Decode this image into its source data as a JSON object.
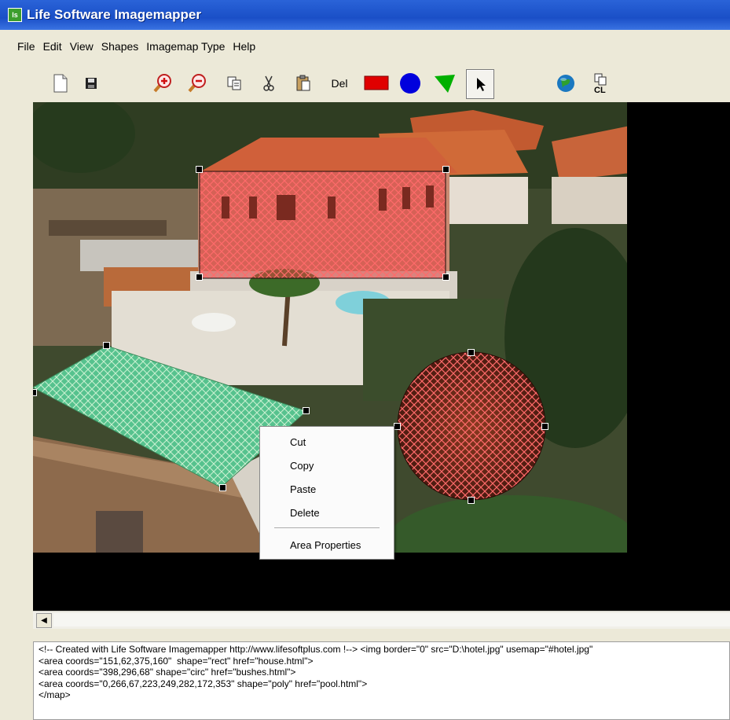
{
  "window": {
    "title": "Life Software Imagemapper",
    "app_icon_label": "ls"
  },
  "menu": [
    "File",
    "Edit",
    "View",
    "Shapes",
    "Imagemap Type",
    "Help"
  ],
  "toolbar": {
    "del_label": "Del"
  },
  "context_menu": {
    "items": [
      "Cut",
      "Copy",
      "Paste",
      "Delete"
    ],
    "properties": "Area Properties"
  },
  "code_lines": [
    "<!-- Created with Life Software Imagemapper http://www.lifesoftplus.com !--> <img border=\"0\" src=\"D:\\hotel.jpg\" usemap=\"#hotel.jpg\"",
    "<area coords=\"151,62,375,160\"  shape=\"rect\" href=\"house.html\">",
    "<area coords=\"398,296,68\" shape=\"circ\" href=\"bushes.html\">",
    "<area coords=\"0,266,67,223,249,282,172,353\" shape=\"poly\" href=\"pool.html\">",
    "</map>"
  ],
  "colors": {
    "title_bar": "#1a4fc7",
    "rect_tool": "#e00000",
    "circle_tool": "#0000dd",
    "poly_tool": "#00b000",
    "selection_hatch": "#d02020"
  }
}
